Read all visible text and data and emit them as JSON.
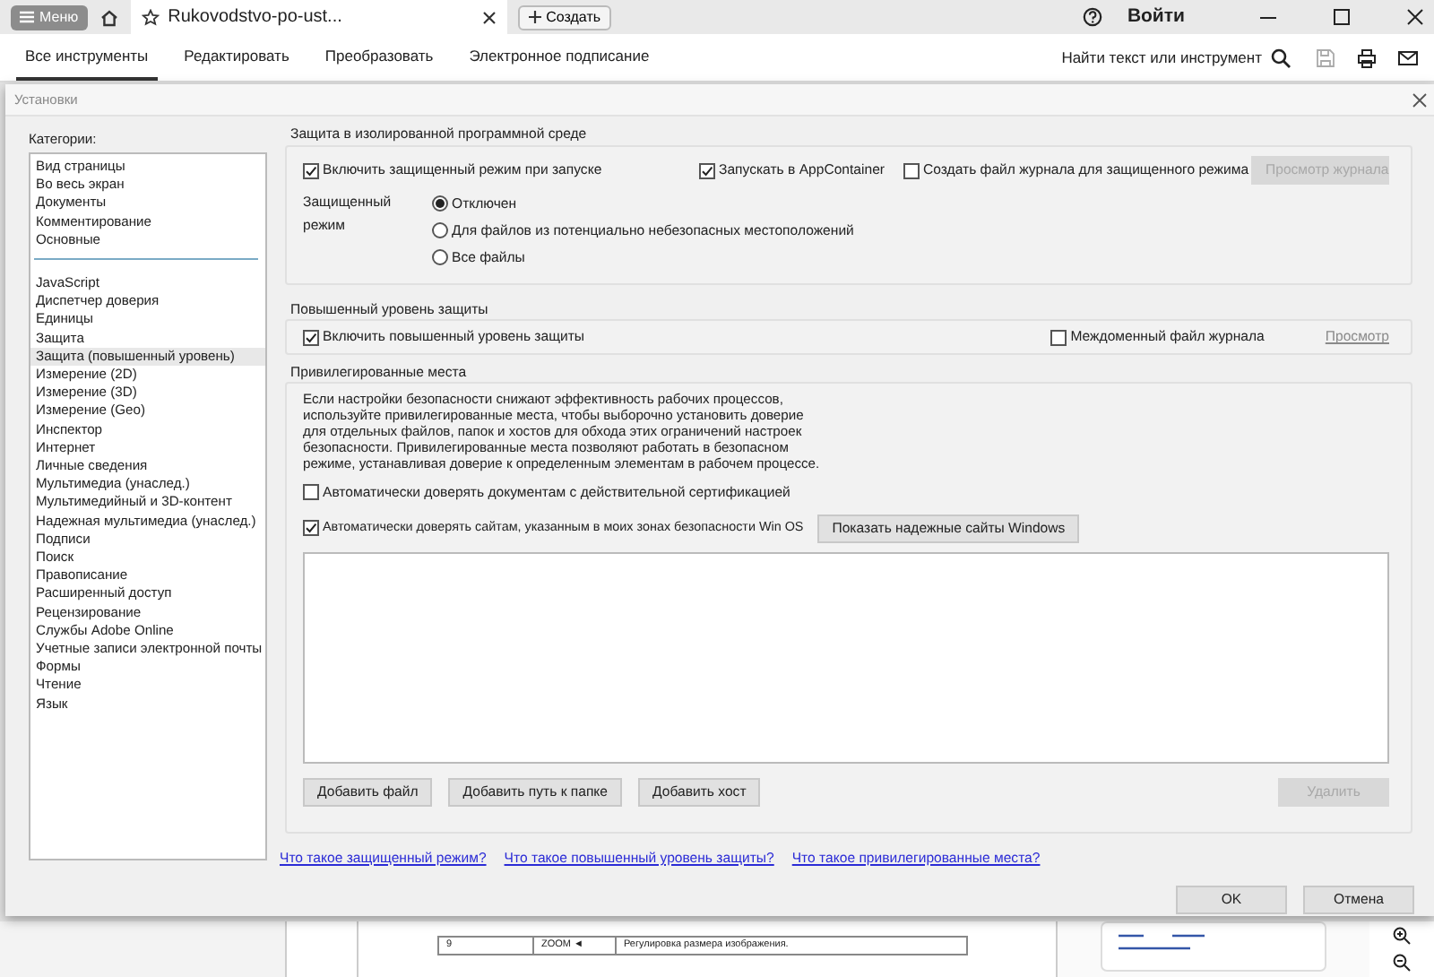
{
  "topbar": {
    "menu_button": "Меню",
    "document_tab": "Rukovodstvo-po-ust...",
    "create_button": "Создать",
    "sign_in": "Войти"
  },
  "toolbar": {
    "tabs": [
      {
        "label": "Все инструменты",
        "selected": true
      },
      {
        "label": "Редактировать",
        "selected": false
      },
      {
        "label": "Преобразовать",
        "selected": false
      },
      {
        "label": "Электронное подписание",
        "selected": false
      }
    ],
    "search_label": "Найти текст или инструмент"
  },
  "dialog": {
    "title": "Установки",
    "categories_label": "Категории:",
    "category_groups": [
      [
        {
          "label": "Вид страницы",
          "selected": false
        },
        {
          "label": "Во весь экран",
          "selected": false
        },
        {
          "label": "Документы",
          "selected": false
        },
        {
          "label": "Комментирование",
          "selected": false
        },
        {
          "label": "Основные",
          "selected": false
        }
      ],
      [
        {
          "label": "JavaScript",
          "selected": false
        },
        {
          "label": "Диспетчер доверия",
          "selected": false
        },
        {
          "label": "Единицы",
          "selected": false
        },
        {
          "label": "Защита",
          "selected": false
        },
        {
          "label": "Защита (повышенный уровень)",
          "selected": true
        },
        {
          "label": "Измерение (2D)",
          "selected": false
        },
        {
          "label": "Измерение (3D)",
          "selected": false
        },
        {
          "label": "Измерение (Geo)",
          "selected": false
        },
        {
          "label": "Инспектор",
          "selected": false
        },
        {
          "label": "Интернет",
          "selected": false
        },
        {
          "label": "Личные сведения",
          "selected": false
        },
        {
          "label": "Мультимедиа (унаслед.)",
          "selected": false
        },
        {
          "label": "Мультимедийный и 3D-контент",
          "selected": false
        },
        {
          "label": "Надежная мультимедиа (унаслед.)",
          "selected": false
        },
        {
          "label": "Подписи",
          "selected": false
        },
        {
          "label": "Поиск",
          "selected": false
        },
        {
          "label": "Правописание",
          "selected": false
        },
        {
          "label": "Расширенный доступ",
          "selected": false
        },
        {
          "label": "Рецензирование",
          "selected": false
        },
        {
          "label": "Службы Adobe Online",
          "selected": false
        },
        {
          "label": "Учетные записи электронной почты",
          "selected": false
        },
        {
          "label": "Формы",
          "selected": false
        },
        {
          "label": "Чтение",
          "selected": false
        },
        {
          "label": "Язык",
          "selected": false
        }
      ]
    ],
    "sandbox": {
      "title": "Защита в изолированной программной среде",
      "options": [
        {
          "label": "Включить защищенный режим при запуске",
          "checked": true
        },
        {
          "label": "Запускать в AppContainer",
          "checked": true
        },
        {
          "label": "Создать файл журнала для защищенного режима",
          "checked": false
        }
      ],
      "view_log_button": {
        "label": "Просмотр журнала",
        "disabled": true
      },
      "mode_label": "Защищенный режим",
      "modes": [
        {
          "label": "Отключен",
          "selected": true
        },
        {
          "label": "Для файлов из потенциально небезопасных местоположений",
          "selected": false
        },
        {
          "label": "Все файлы",
          "selected": false
        }
      ]
    },
    "enhanced": {
      "title": "Повышенный уровень защиты",
      "option": {
        "label": "Включить повышенный уровень защиты",
        "checked": true
      },
      "cross_domain": {
        "label": "Междоменный файл журнала",
        "checked": false
      },
      "view_link": {
        "label": "Просмотр",
        "disabled": true
      }
    },
    "privileged": {
      "title": "Привилегированные места",
      "description": "Если настройки безопасности снижают эффективность рабочих процессов, используйте привилегированные места, чтобы выборочно установить доверие для отдельных файлов, папок и хостов для обхода этих ограничений настроек безопасности. Привилегированные места позволяют работать в безопасном режиме, устанавливая доверие к определенным элементам в рабочем процессе.",
      "options": [
        {
          "label": "Автоматически доверять документам с действительной сертификацией",
          "checked": false
        },
        {
          "label": "Автоматически доверять сайтам, указанным в моих зонах безопасности Win OS",
          "checked": true
        }
      ],
      "windows_sites_button": "Показать надежные сайты Windows",
      "add_buttons": [
        "Добавить файл",
        "Добавить путь к папке",
        "Добавить хост"
      ],
      "remove_button": {
        "label": "Удалить",
        "disabled": true
      }
    },
    "help_links": [
      "Что такое защищенный режим?",
      "Что такое повышенный уровень защиты?",
      "Что такое привилегированные места?"
    ],
    "footer_buttons": [
      "OK",
      "Отмена"
    ]
  },
  "document": {
    "table_row": [
      "9",
      "ZOOM ◄",
      "Регулировка размера изображения."
    ]
  }
}
